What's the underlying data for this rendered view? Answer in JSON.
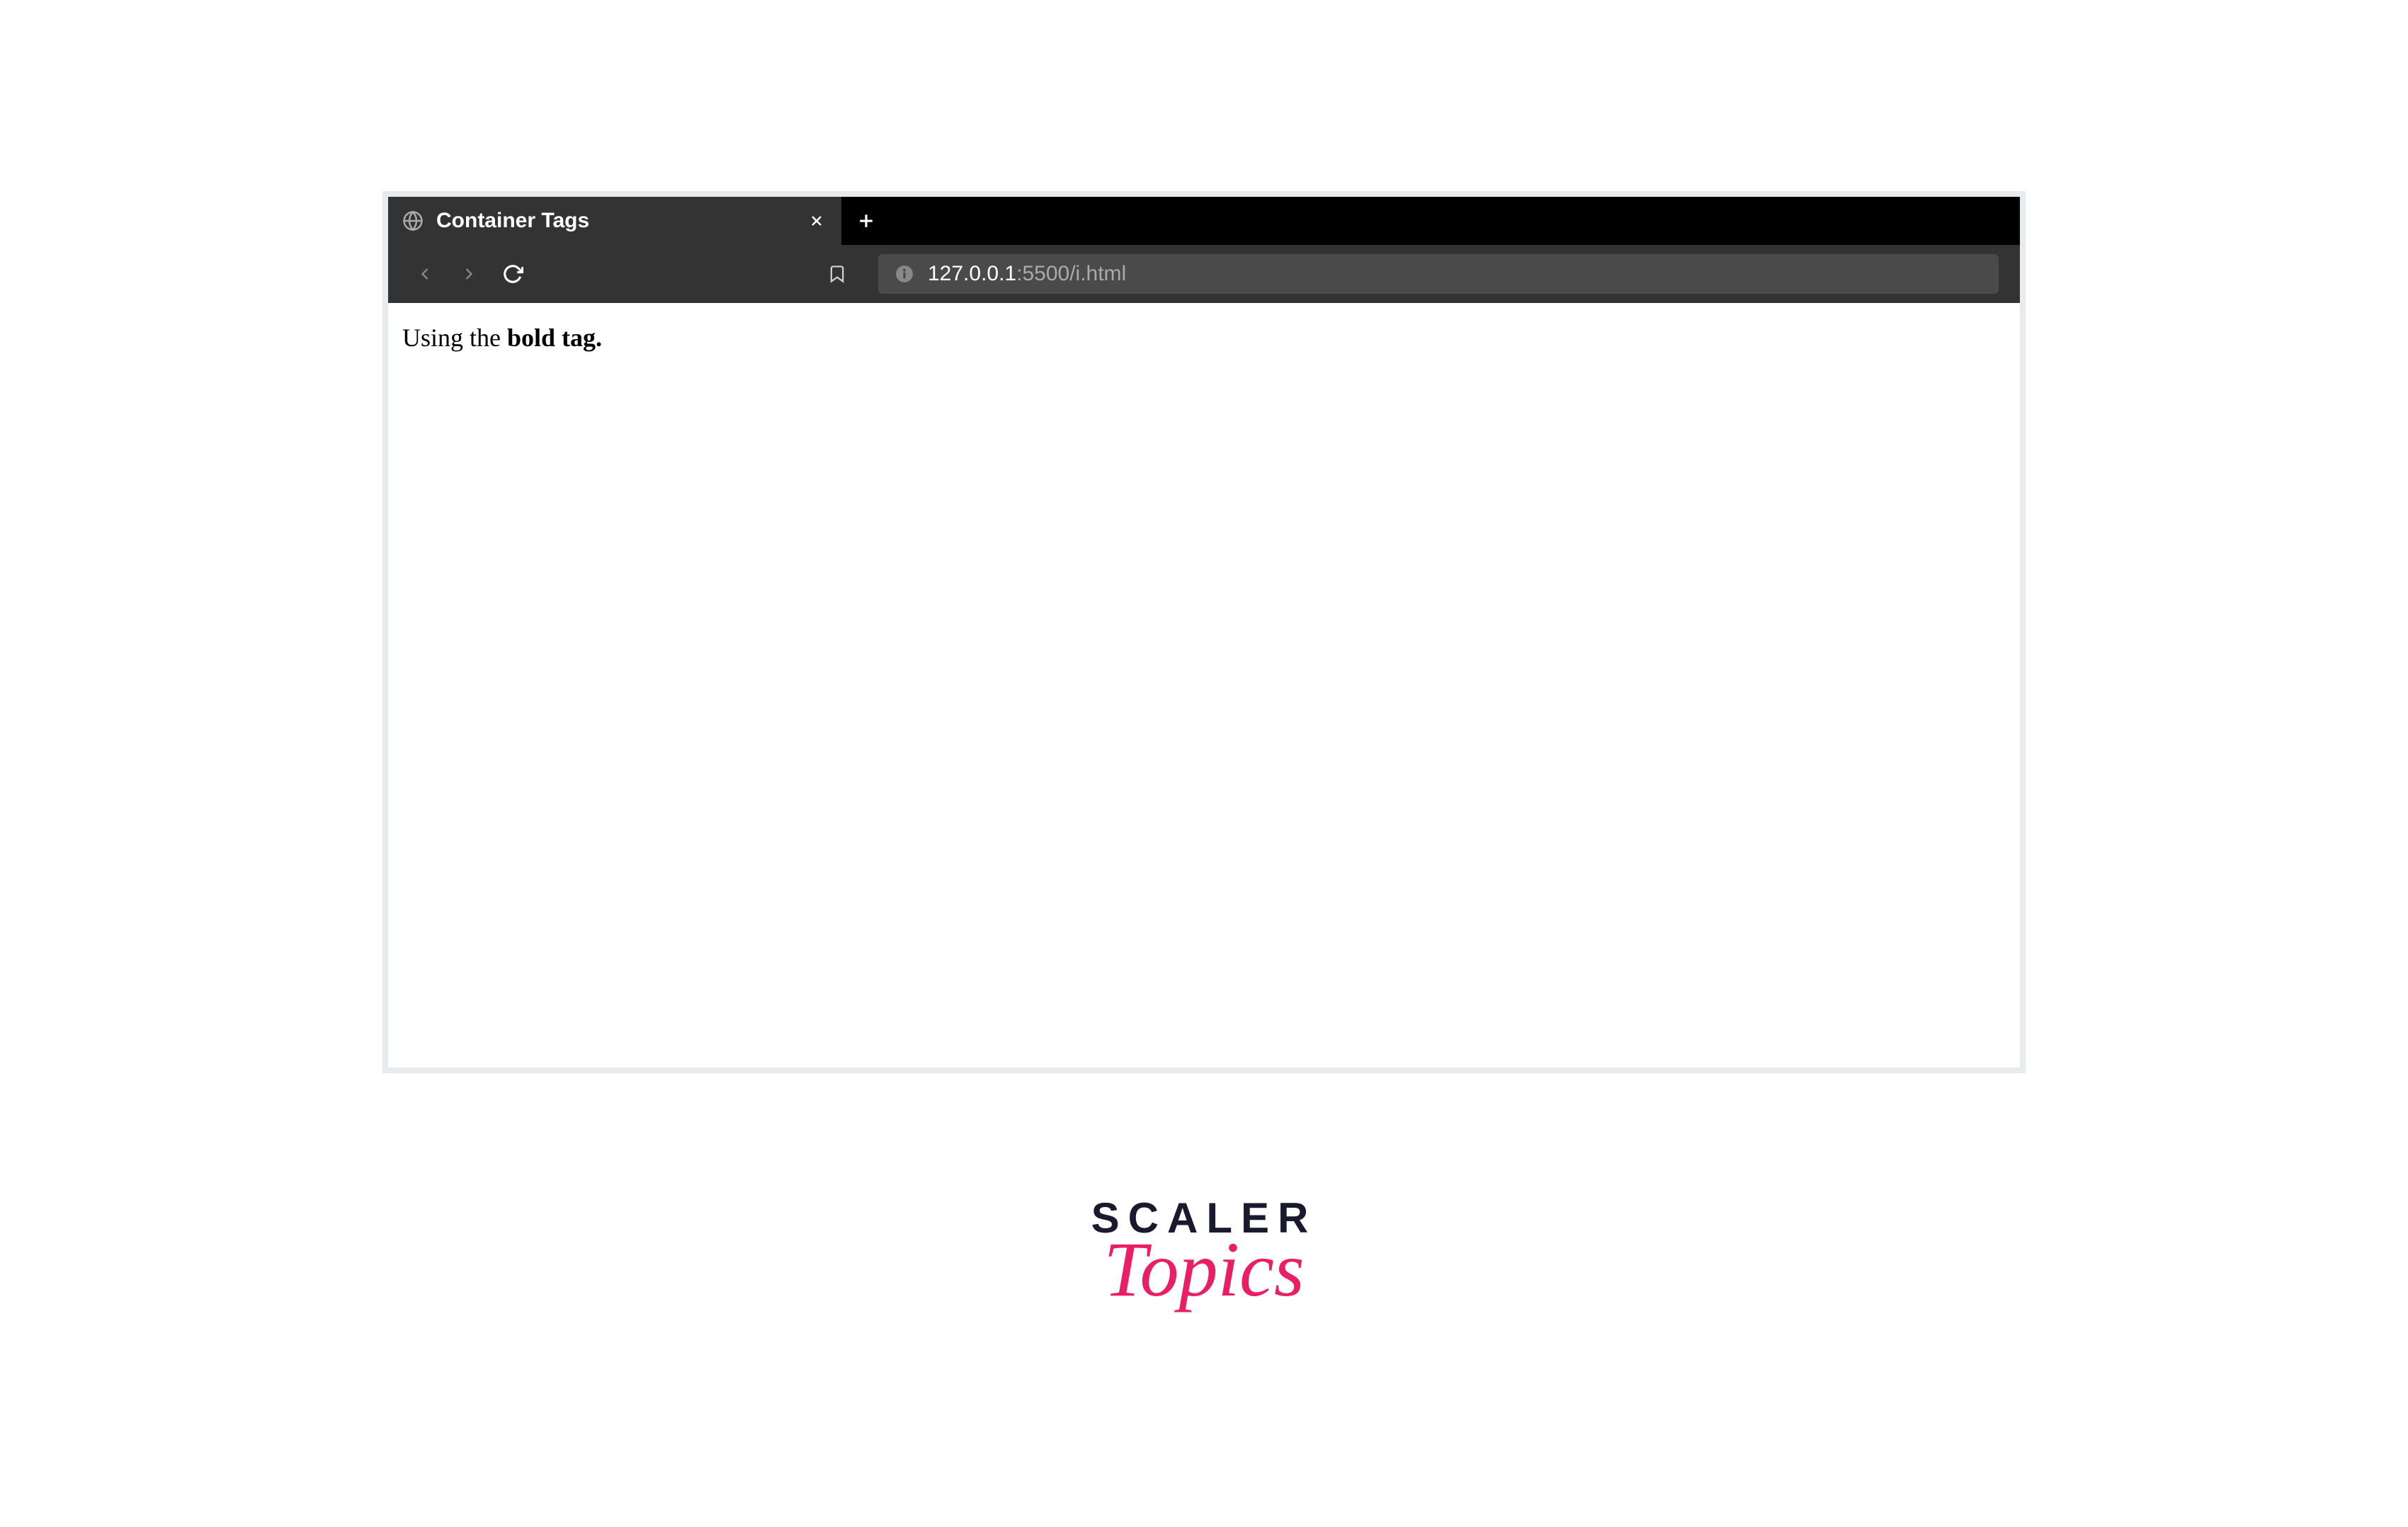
{
  "browser": {
    "tab": {
      "title": "Container Tags"
    },
    "url": {
      "host": "127.0.0.1",
      "path": ":5500/i.html"
    }
  },
  "page": {
    "text_prefix": "Using the ",
    "text_bold": "bold tag."
  },
  "branding": {
    "scaler": "SCALER",
    "topics": "Topics"
  }
}
